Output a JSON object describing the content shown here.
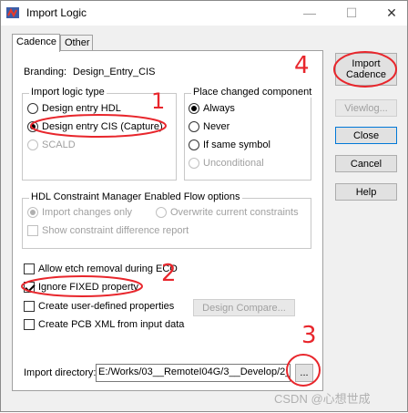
{
  "window": {
    "title": "Import Logic",
    "minimize": "—",
    "maximize": "☐",
    "close": "✕"
  },
  "tabs": [
    {
      "label": "Cadence"
    },
    {
      "label": "Other"
    }
  ],
  "branding": {
    "label": "Branding:",
    "value": "Design_Entry_CIS"
  },
  "import_logic_type": {
    "title": "Import logic type",
    "options": [
      {
        "label": "Design entry HDL",
        "selected": false,
        "enabled": true
      },
      {
        "label": "Design entry CIS (Capture)",
        "selected": true,
        "enabled": true
      },
      {
        "label": "SCALD",
        "selected": false,
        "enabled": false
      }
    ]
  },
  "place_changed": {
    "title": "Place changed component",
    "options": [
      {
        "label": "Always",
        "selected": true,
        "enabled": true
      },
      {
        "label": "Never",
        "selected": false,
        "enabled": true
      },
      {
        "label": "If same symbol",
        "selected": false,
        "enabled": true
      },
      {
        "label": "Unconditional",
        "selected": false,
        "enabled": false
      }
    ]
  },
  "hdl_cm": {
    "title": "HDL Constraint Manager Enabled Flow options",
    "import_changes": "Import changes only",
    "overwrite": "Overwrite current constraints",
    "show_diff": "Show constraint difference report"
  },
  "options": {
    "allow_etch": "Allow etch removal during ECO",
    "ignore_fixed": "Ignore FIXED property",
    "user_defined": "Create user-defined properties",
    "pcb_xml": "Create PCB XML from input data",
    "design_compare": "Design Compare..."
  },
  "import_dir": {
    "label": "Import directory:",
    "value": "E:/Works/03__RemoteI04G/3__Develop/2_",
    "browse": "..."
  },
  "buttons": {
    "import_line1": "Import",
    "import_line2": "Cadence",
    "viewlog": "Viewlog...",
    "close": "Close",
    "cancel": "Cancel",
    "help": "Help"
  },
  "annotations": {
    "n1": "1",
    "n2": "2",
    "n3": "3",
    "n4": "4",
    "annotation_color": "#e8262c"
  },
  "watermark": "CSDN @心想世成"
}
